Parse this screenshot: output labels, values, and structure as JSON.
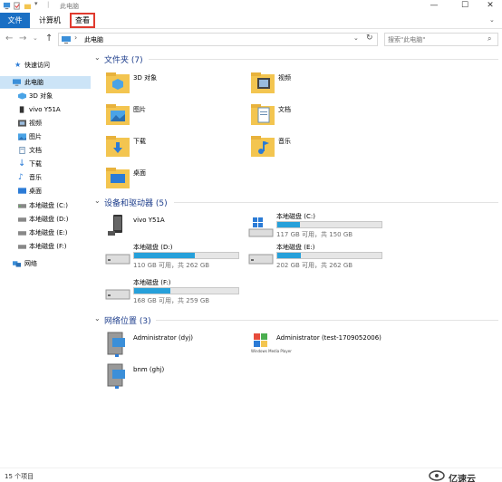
{
  "window": {
    "title": "此电脑",
    "controls": {
      "minimize": "—",
      "maximize": "☐",
      "close": "✕"
    }
  },
  "menu": {
    "file": "文件",
    "computer": "计算机",
    "view": "查看"
  },
  "address": {
    "path": "此电脑",
    "search_placeholder": "搜索\"此电脑\""
  },
  "sidebar": {
    "quick_access": "快速访问",
    "this_pc": "此电脑",
    "items": [
      "3D 对象",
      "vivo Y51A",
      "视频",
      "图片",
      "文档",
      "下载",
      "音乐",
      "桌面",
      "本地磁盘 (C:)",
      "本地磁盘 (D:)",
      "本地磁盘 (E:)",
      "本地磁盘 (F:)"
    ],
    "network": "网络"
  },
  "groups": {
    "folders": "文件夹 (7)",
    "devices": "设备和驱动器 (5)",
    "network": "网络位置 (3)"
  },
  "folders": [
    "3D 对象",
    "视频",
    "图片",
    "文档",
    "下载",
    "音乐",
    "桌面"
  ],
  "devices": {
    "phone": "vivo Y51A",
    "drives": [
      {
        "name": "本地磁盘 (C:)",
        "free": "117 GB 可用，共 150 GB",
        "used_fraction": 0.22
      },
      {
        "name": "本地磁盘 (D:)",
        "free": "110 GB 可用，共 262 GB",
        "used_fraction": 0.58
      },
      {
        "name": "本地磁盘 (E:)",
        "free": "202 GB 可用，共 262 GB",
        "used_fraction": 0.23
      },
      {
        "name": "本地磁盘 (F:)",
        "free": "168 GB 可用，共 259 GB",
        "used_fraction": 0.35
      }
    ]
  },
  "network_locations": [
    "Administrator (dyj)",
    "Administrator (test-1709052006)",
    "bnm (ghj)"
  ],
  "status": {
    "count": "15 个项目"
  },
  "watermark": "亿速云",
  "colors": {
    "accent": "#1a6fc4",
    "highlight_border": "#e03a2e",
    "header_text": "#1e3e8c",
    "drive_fill": "#26a0da",
    "folder": "#f3c550"
  }
}
